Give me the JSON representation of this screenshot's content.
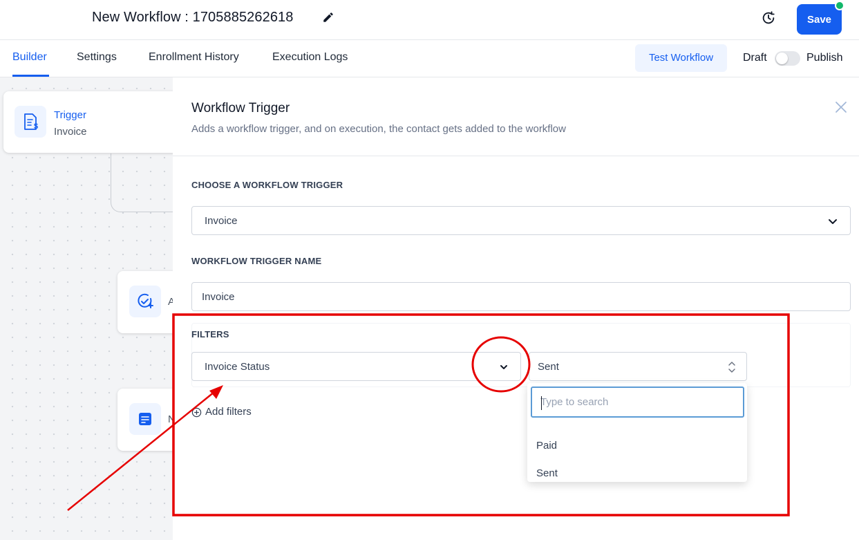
{
  "header": {
    "workflow_title": "New Workflow : 1705885262618",
    "save_label": "Save"
  },
  "tabs": [
    {
      "label": "Builder",
      "active": true
    },
    {
      "label": "Settings",
      "active": false
    },
    {
      "label": "Enrollment History",
      "active": false
    },
    {
      "label": "Execution Logs",
      "active": false
    }
  ],
  "toolbar": {
    "test_label": "Test Workflow",
    "draft_label": "Draft",
    "publish_label": "Publish",
    "publish_on": false
  },
  "canvas": {
    "trigger_node": {
      "title": "Trigger",
      "subtitle": "Invoice"
    },
    "action_node_letter": "A",
    "note_node_letter": "N"
  },
  "panel": {
    "title": "Workflow Trigger",
    "subtitle": "Adds a workflow trigger, and on execution, the contact gets added to the workflow",
    "choose_trigger_label": "CHOOSE A WORKFLOW TRIGGER",
    "trigger_value": "Invoice",
    "trigger_name_label": "WORKFLOW TRIGGER NAME",
    "trigger_name_value": "Invoice",
    "filters_label": "FILTERS",
    "filter_field": "Invoice Status",
    "filter_value": "Sent",
    "add_filters_label": "Add filters",
    "search_placeholder": "Type to search",
    "options": [
      "Paid",
      "Sent"
    ]
  },
  "colors": {
    "accent": "#155eef",
    "annotation": "#e60000",
    "status_dot": "#12b76a"
  },
  "icons": [
    "edit-icon",
    "history-icon",
    "invoice-icon",
    "check-plus-icon",
    "note-icon",
    "close-icon",
    "chevron-down-icon",
    "sort-icon",
    "plus-circle-icon"
  ]
}
